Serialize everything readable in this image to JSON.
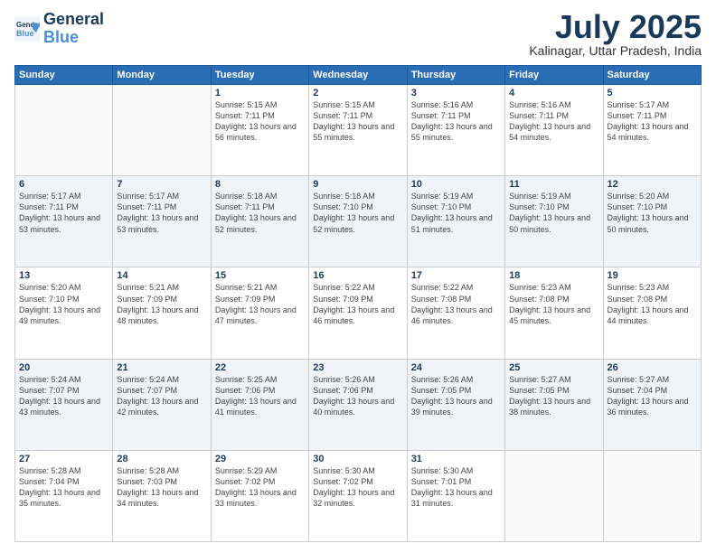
{
  "header": {
    "logo_line1": "General",
    "logo_line2": "Blue",
    "month": "July 2025",
    "location": "Kalinagar, Uttar Pradesh, India"
  },
  "weekdays": [
    "Sunday",
    "Monday",
    "Tuesday",
    "Wednesday",
    "Thursday",
    "Friday",
    "Saturday"
  ],
  "weeks": [
    [
      {
        "day": "",
        "sunrise": "",
        "sunset": "",
        "daylight": ""
      },
      {
        "day": "",
        "sunrise": "",
        "sunset": "",
        "daylight": ""
      },
      {
        "day": "1",
        "sunrise": "Sunrise: 5:15 AM",
        "sunset": "Sunset: 7:11 PM",
        "daylight": "Daylight: 13 hours and 56 minutes."
      },
      {
        "day": "2",
        "sunrise": "Sunrise: 5:15 AM",
        "sunset": "Sunset: 7:11 PM",
        "daylight": "Daylight: 13 hours and 55 minutes."
      },
      {
        "day": "3",
        "sunrise": "Sunrise: 5:16 AM",
        "sunset": "Sunset: 7:11 PM",
        "daylight": "Daylight: 13 hours and 55 minutes."
      },
      {
        "day": "4",
        "sunrise": "Sunrise: 5:16 AM",
        "sunset": "Sunset: 7:11 PM",
        "daylight": "Daylight: 13 hours and 54 minutes."
      },
      {
        "day": "5",
        "sunrise": "Sunrise: 5:17 AM",
        "sunset": "Sunset: 7:11 PM",
        "daylight": "Daylight: 13 hours and 54 minutes."
      }
    ],
    [
      {
        "day": "6",
        "sunrise": "Sunrise: 5:17 AM",
        "sunset": "Sunset: 7:11 PM",
        "daylight": "Daylight: 13 hours and 53 minutes."
      },
      {
        "day": "7",
        "sunrise": "Sunrise: 5:17 AM",
        "sunset": "Sunset: 7:11 PM",
        "daylight": "Daylight: 13 hours and 53 minutes."
      },
      {
        "day": "8",
        "sunrise": "Sunrise: 5:18 AM",
        "sunset": "Sunset: 7:11 PM",
        "daylight": "Daylight: 13 hours and 52 minutes."
      },
      {
        "day": "9",
        "sunrise": "Sunrise: 5:18 AM",
        "sunset": "Sunset: 7:10 PM",
        "daylight": "Daylight: 13 hours and 52 minutes."
      },
      {
        "day": "10",
        "sunrise": "Sunrise: 5:19 AM",
        "sunset": "Sunset: 7:10 PM",
        "daylight": "Daylight: 13 hours and 51 minutes."
      },
      {
        "day": "11",
        "sunrise": "Sunrise: 5:19 AM",
        "sunset": "Sunset: 7:10 PM",
        "daylight": "Daylight: 13 hours and 50 minutes."
      },
      {
        "day": "12",
        "sunrise": "Sunrise: 5:20 AM",
        "sunset": "Sunset: 7:10 PM",
        "daylight": "Daylight: 13 hours and 50 minutes."
      }
    ],
    [
      {
        "day": "13",
        "sunrise": "Sunrise: 5:20 AM",
        "sunset": "Sunset: 7:10 PM",
        "daylight": "Daylight: 13 hours and 49 minutes."
      },
      {
        "day": "14",
        "sunrise": "Sunrise: 5:21 AM",
        "sunset": "Sunset: 7:09 PM",
        "daylight": "Daylight: 13 hours and 48 minutes."
      },
      {
        "day": "15",
        "sunrise": "Sunrise: 5:21 AM",
        "sunset": "Sunset: 7:09 PM",
        "daylight": "Daylight: 13 hours and 47 minutes."
      },
      {
        "day": "16",
        "sunrise": "Sunrise: 5:22 AM",
        "sunset": "Sunset: 7:09 PM",
        "daylight": "Daylight: 13 hours and 46 minutes."
      },
      {
        "day": "17",
        "sunrise": "Sunrise: 5:22 AM",
        "sunset": "Sunset: 7:08 PM",
        "daylight": "Daylight: 13 hours and 46 minutes."
      },
      {
        "day": "18",
        "sunrise": "Sunrise: 5:23 AM",
        "sunset": "Sunset: 7:08 PM",
        "daylight": "Daylight: 13 hours and 45 minutes."
      },
      {
        "day": "19",
        "sunrise": "Sunrise: 5:23 AM",
        "sunset": "Sunset: 7:08 PM",
        "daylight": "Daylight: 13 hours and 44 minutes."
      }
    ],
    [
      {
        "day": "20",
        "sunrise": "Sunrise: 5:24 AM",
        "sunset": "Sunset: 7:07 PM",
        "daylight": "Daylight: 13 hours and 43 minutes."
      },
      {
        "day": "21",
        "sunrise": "Sunrise: 5:24 AM",
        "sunset": "Sunset: 7:07 PM",
        "daylight": "Daylight: 13 hours and 42 minutes."
      },
      {
        "day": "22",
        "sunrise": "Sunrise: 5:25 AM",
        "sunset": "Sunset: 7:06 PM",
        "daylight": "Daylight: 13 hours and 41 minutes."
      },
      {
        "day": "23",
        "sunrise": "Sunrise: 5:26 AM",
        "sunset": "Sunset: 7:06 PM",
        "daylight": "Daylight: 13 hours and 40 minutes."
      },
      {
        "day": "24",
        "sunrise": "Sunrise: 5:26 AM",
        "sunset": "Sunset: 7:05 PM",
        "daylight": "Daylight: 13 hours and 39 minutes."
      },
      {
        "day": "25",
        "sunrise": "Sunrise: 5:27 AM",
        "sunset": "Sunset: 7:05 PM",
        "daylight": "Daylight: 13 hours and 38 minutes."
      },
      {
        "day": "26",
        "sunrise": "Sunrise: 5:27 AM",
        "sunset": "Sunset: 7:04 PM",
        "daylight": "Daylight: 13 hours and 36 minutes."
      }
    ],
    [
      {
        "day": "27",
        "sunrise": "Sunrise: 5:28 AM",
        "sunset": "Sunset: 7:04 PM",
        "daylight": "Daylight: 13 hours and 35 minutes."
      },
      {
        "day": "28",
        "sunrise": "Sunrise: 5:28 AM",
        "sunset": "Sunset: 7:03 PM",
        "daylight": "Daylight: 13 hours and 34 minutes."
      },
      {
        "day": "29",
        "sunrise": "Sunrise: 5:29 AM",
        "sunset": "Sunset: 7:02 PM",
        "daylight": "Daylight: 13 hours and 33 minutes."
      },
      {
        "day": "30",
        "sunrise": "Sunrise: 5:30 AM",
        "sunset": "Sunset: 7:02 PM",
        "daylight": "Daylight: 13 hours and 32 minutes."
      },
      {
        "day": "31",
        "sunrise": "Sunrise: 5:30 AM",
        "sunset": "Sunset: 7:01 PM",
        "daylight": "Daylight: 13 hours and 31 minutes."
      },
      {
        "day": "",
        "sunrise": "",
        "sunset": "",
        "daylight": ""
      },
      {
        "day": "",
        "sunrise": "",
        "sunset": "",
        "daylight": ""
      }
    ]
  ]
}
